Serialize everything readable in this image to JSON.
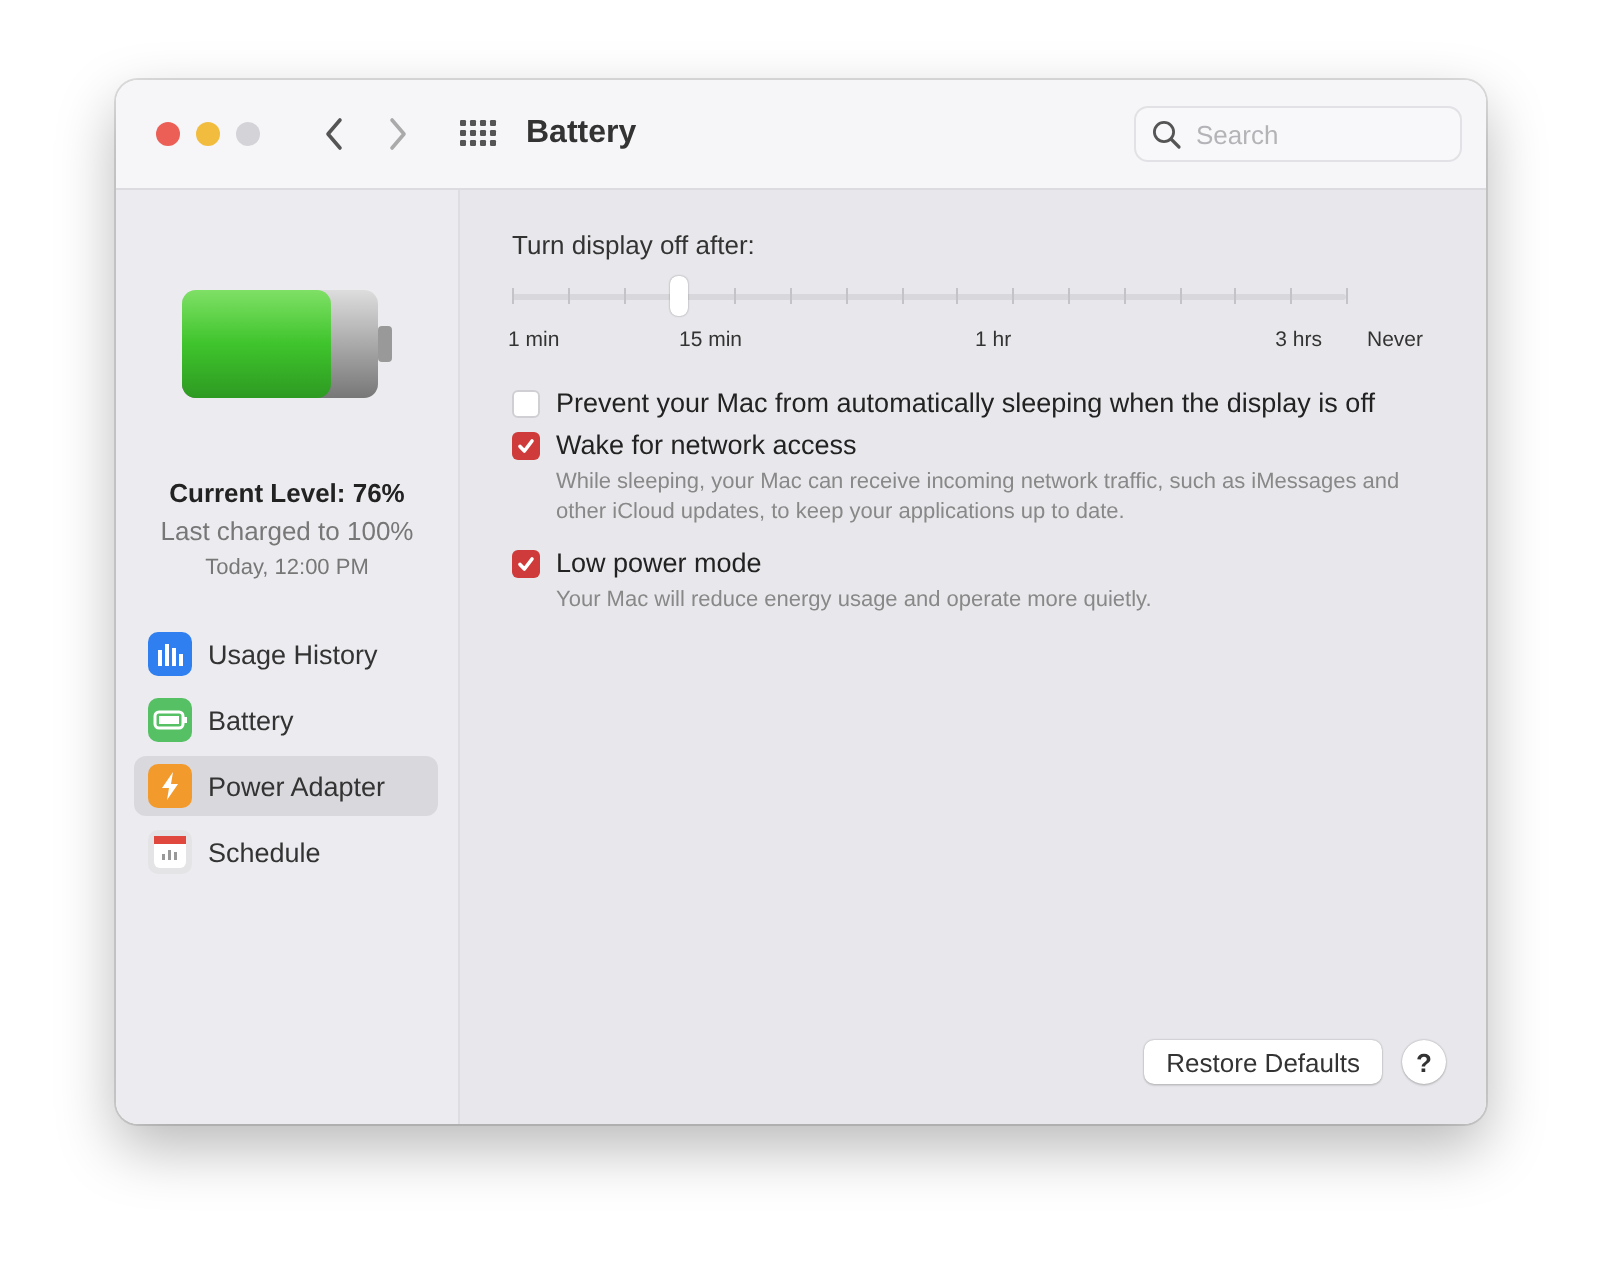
{
  "window": {
    "title": "Battery"
  },
  "search": {
    "placeholder": "Search"
  },
  "sidebar": {
    "battery": {
      "level": 0.76
    },
    "current_level": "Current Level: 76%",
    "last_charged": "Last charged to 100%",
    "charged_time": "Today, 12:00 PM",
    "items": [
      {
        "label": "Usage History",
        "selected": false
      },
      {
        "label": "Battery",
        "selected": false
      },
      {
        "label": "Power Adapter",
        "selected": true
      },
      {
        "label": "Schedule",
        "selected": false
      }
    ]
  },
  "display_off": {
    "label": "Turn display off after:",
    "level": 0.2,
    "tick_labels": [
      "1 min",
      "15 min",
      "1 hr",
      "3 hrs",
      "Never"
    ]
  },
  "options": [
    {
      "label": "Prevent your Mac from automatically sleeping when the display is off",
      "checked": false
    },
    {
      "label": "Wake for network access",
      "checked": true,
      "description": "While sleeping, your Mac can receive incoming network traffic, such as iMessages and other iCloud updates, to keep your applications up to date."
    },
    {
      "label": "Low power mode",
      "checked": true,
      "description": "Your Mac will reduce energy usage and operate more quietly."
    }
  ],
  "buttons": {
    "restore": "Restore Defaults",
    "help": "?"
  }
}
